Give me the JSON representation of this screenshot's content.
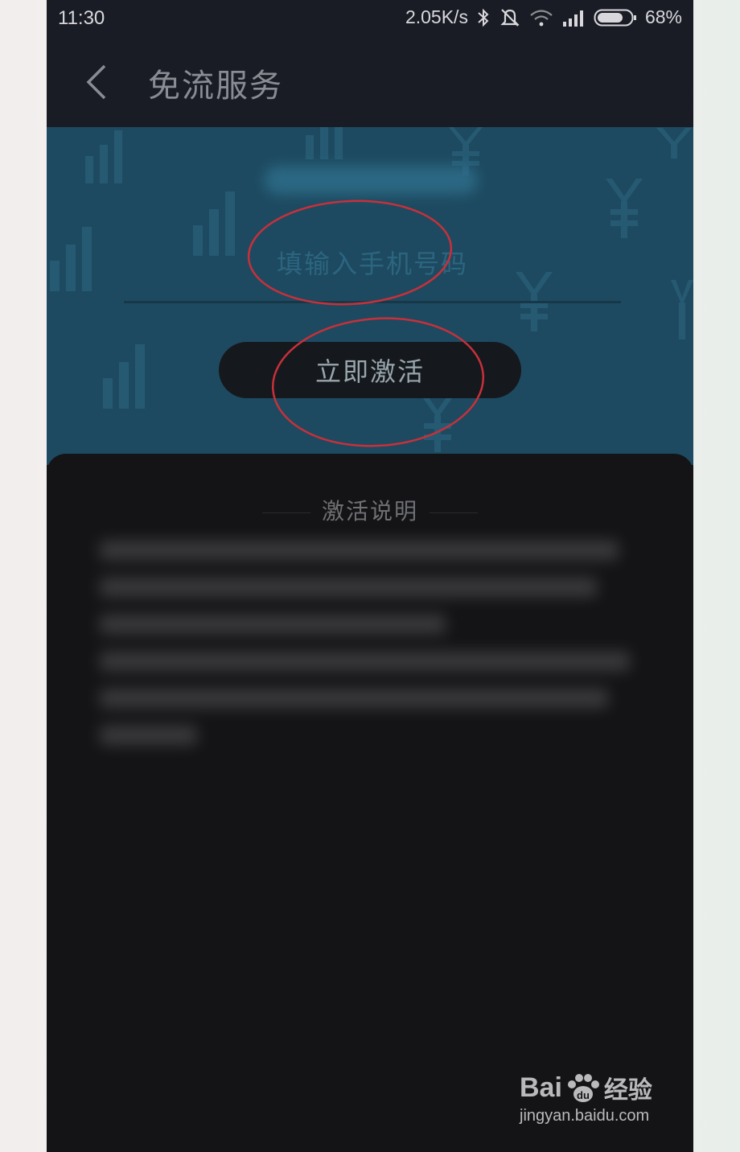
{
  "status_bar": {
    "time": "11:30",
    "speed": "2.05K/s",
    "battery": "68%",
    "icons": [
      "bluetooth-icon",
      "mute-icon",
      "wifi-icon",
      "signal-icon",
      "battery-icon"
    ]
  },
  "app_bar": {
    "title": "免流服务"
  },
  "form": {
    "phone_placeholder": "填输入手机号码",
    "activate_label": "立即激活"
  },
  "instructions": {
    "title": "激活说明"
  },
  "watermark": {
    "logo_text": "Bai",
    "logo_suffix": "经验",
    "url": "jingyan.baidu.com"
  },
  "colors": {
    "app_bar": "#1a1c25",
    "banner": "#1d4a60",
    "panel": "#141416",
    "annotation": "#c8303a"
  }
}
